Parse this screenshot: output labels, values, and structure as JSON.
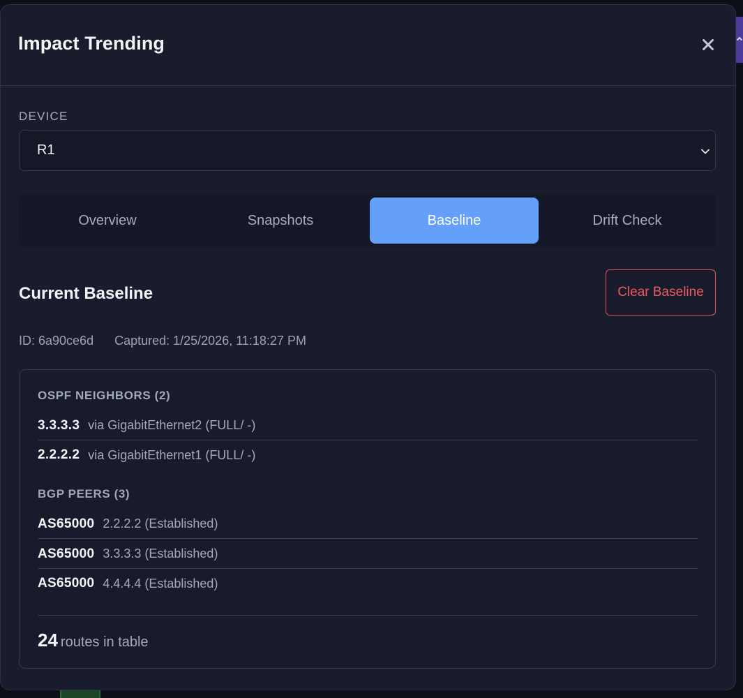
{
  "modal": {
    "title": "Impact Trending"
  },
  "device": {
    "label": "DEVICE",
    "selected": "R1"
  },
  "tabs": [
    {
      "label": "Overview"
    },
    {
      "label": "Snapshots"
    },
    {
      "label": "Baseline"
    },
    {
      "label": "Drift Check"
    }
  ],
  "active_tab": "Baseline",
  "baseline": {
    "title": "Current Baseline",
    "clear_label": "Clear Baseline",
    "id_text": "ID: 6a90ce6d",
    "captured_text": "Captured: 1/25/2026, 11:18:27 PM",
    "ospf": {
      "heading": "OSPF NEIGHBORS (2)",
      "rows": [
        {
          "key": "3.3.3.3",
          "detail": "via GigabitEthernet2 (FULL/ -)"
        },
        {
          "key": "2.2.2.2",
          "detail": "via GigabitEthernet1 (FULL/ -)"
        }
      ]
    },
    "bgp": {
      "heading": "BGP PEERS (3)",
      "rows": [
        {
          "key": "AS65000",
          "detail": "2.2.2.2 (Established)"
        },
        {
          "key": "AS65000",
          "detail": "3.3.3.3 (Established)"
        },
        {
          "key": "AS65000",
          "detail": "4.4.4.4 (Established)"
        }
      ]
    },
    "routes": {
      "count": "24",
      "label": "routes in table"
    }
  },
  "icons": {
    "close": "close-icon",
    "dropdown": "chevron-down-icon"
  },
  "colors": {
    "accent": "#64a0f9",
    "danger": "#ef5a5e",
    "modal_bg": "#181c2d"
  }
}
